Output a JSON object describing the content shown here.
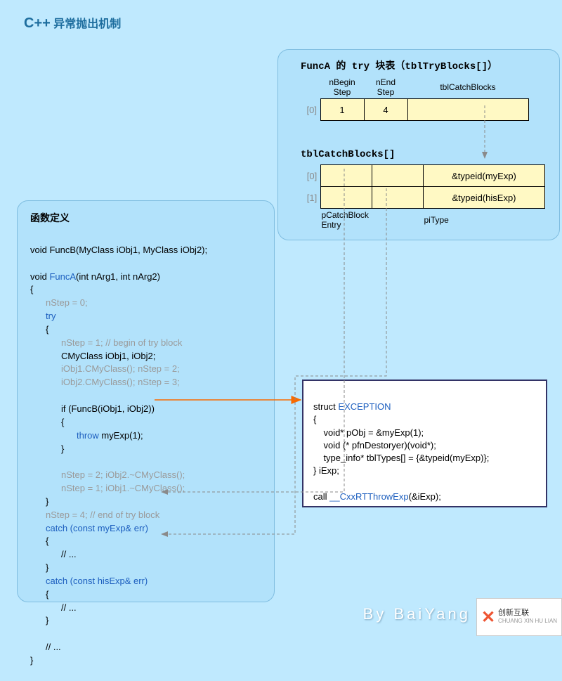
{
  "title_main": "C++",
  "title_sub": " 异常抛出机制",
  "func_def_title": "函数定义",
  "try_table": {
    "title": "FuncA 的 try 块表（tblTryBlocks[]）",
    "headers": [
      "nBegin\nStep",
      "nEnd\nStep",
      "tblCatchBlocks"
    ],
    "row0": {
      "idx": "[0]",
      "c0": "1",
      "c1": "4",
      "c2": ""
    }
  },
  "catch_table": {
    "title": "tblCatchBlocks[]",
    "row0": {
      "idx": "[0]",
      "c0": "",
      "c1": "",
      "c2": "&typeid(myExp)"
    },
    "row1": {
      "idx": "[1]",
      "c0": "",
      "c1": "",
      "c2": "&typeid(hisExp)"
    },
    "labels": [
      "pCatchBlock\nEntry",
      "piType"
    ]
  },
  "code": {
    "l1": "void FuncB(MyClass iObj1, MyClass iObj2);",
    "l2a": "void ",
    "l2b": "FuncA",
    "l2c": "(int nArg1, int nArg2)",
    "l3": "{",
    "l4": "nStep = 0;",
    "l5": "try",
    "l6": "{",
    "l7": "nStep = 1; // begin of try block",
    "l8": "CMyClass iObj1, iObj2;",
    "l9": "iObj1.CMyClass(); nStep = 2;",
    "l10": "iObj2.CMyClass(); nStep = 3;",
    "l11": "if (FuncB(iObj1, iObj2))",
    "l12": "{",
    "l13a": "throw",
    "l13b": " myExp(1);",
    "l14": "}",
    "l15": "nStep = 2; iObj2.~CMyClass();",
    "l16": "nStep = 1; iObj1.~CMyClass();",
    "l17": "}",
    "l18": "nStep = 4; // end of try block",
    "l19": "catch (const myExp& err)",
    "l20": "{",
    "l21": "// ...",
    "l22": "}",
    "l23": "catch (const hisExp& err)",
    "l24": "{",
    "l25": "// ...",
    "l26": "}",
    "l27": "// ...",
    "l28": "}"
  },
  "exc": {
    "l1a": "struct ",
    "l1b": "EXCEPTION",
    "l2": "{",
    "l3": "    void* pObj = &myExp(1);",
    "l4": "    void (* pfnDestoryer)(void*);",
    "l5": "    type_info* tblTypes[] = {&typeid(myExp)};",
    "l6": "} iExp;",
    "l7a": "call ",
    "l7b": "__CxxRTThrowExp",
    "l7c": "(&iExp);"
  },
  "credit": "By BaiYang",
  "logo": {
    "cn": "创新互联",
    "py": "CHUANG XIN HU LIAN"
  }
}
